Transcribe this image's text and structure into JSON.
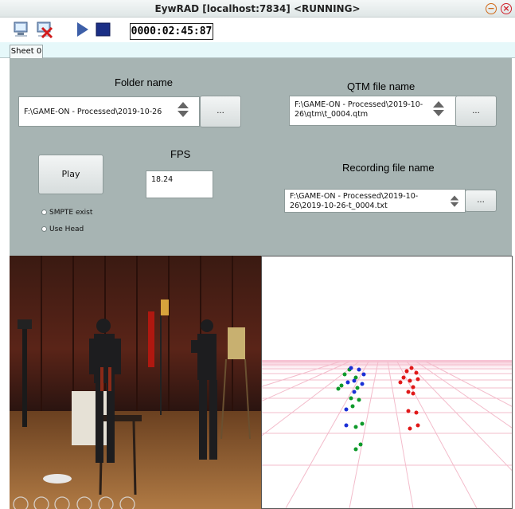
{
  "window": {
    "title": "EywRAD [localhost:7834] <RUNNING>",
    "minimize_glyph": "−",
    "close_glyph": "×"
  },
  "toolbar": {
    "icons": [
      "computer-icon",
      "computer-disconnect-icon",
      "play-icon",
      "stop-icon"
    ],
    "timecode": "0000:02:45:87"
  },
  "tabs": [
    {
      "label": "Sheet 0"
    }
  ],
  "panel": {
    "folder_label": "Folder name",
    "folder_value": "F:\\GAME-ON - Processed\\2019-10-26",
    "folder_browse": "...",
    "qtm_label": "QTM file name",
    "qtm_value": "F:\\GAME-ON - Processed\\2019-10-26\\qtm\\t_0004.qtm",
    "qtm_browse": "...",
    "play_label": "Play",
    "fps_label": "FPS",
    "fps_value": "18.24",
    "recording_label": "Recording file name",
    "recording_value": "F:\\GAME-ON - Processed\\2019-10-26\\2019-10-26-t_0004.txt",
    "recording_browse": "...",
    "smpte_label": "SMPTE exist",
    "usehead_label": "Use Head"
  },
  "colors": {
    "panel_bg": "#a7b4b3",
    "tab_strip": "#e6f8fa",
    "grid_pink": "#f4b8c8",
    "marker_blue": "#1a2fd6",
    "marker_green": "#0e9a2a",
    "marker_red": "#e01818"
  }
}
